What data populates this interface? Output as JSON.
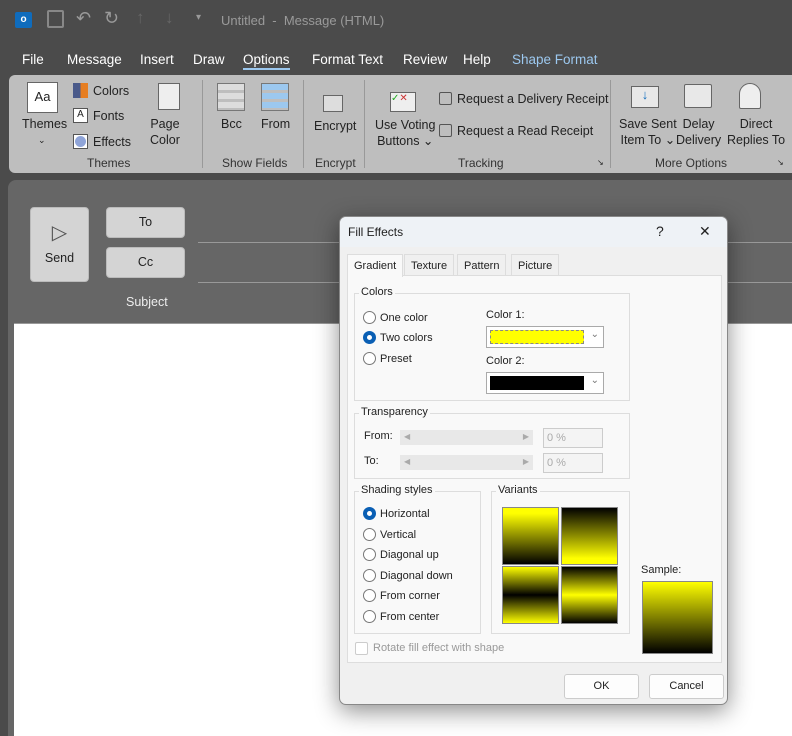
{
  "titlebar": {
    "title": "Untitled  -  Message (HTML)"
  },
  "tabs": [
    "File",
    "Message",
    "Insert",
    "Draw",
    "Options",
    "Format Text",
    "Review",
    "Help",
    "Shape Format"
  ],
  "active_tab": "Options",
  "ribbon": {
    "themes": {
      "themes": "Themes",
      "colors": "Colors",
      "fonts": "Fonts",
      "effects": "Effects",
      "page_color_1": "Page",
      "page_color_2": "Color",
      "group": "Themes"
    },
    "show_fields": {
      "bcc": "Bcc",
      "from": "From",
      "group": "Show Fields"
    },
    "encrypt": {
      "encrypt": "Encrypt",
      "group": "Encrypt"
    },
    "tracking": {
      "voting_1": "Use Voting",
      "voting_2": "Buttons",
      "delivery": "Request a Delivery Receipt",
      "read": "Request a Read Receipt",
      "group": "Tracking"
    },
    "more": {
      "save_1": "Save Sent",
      "save_2": "Item To",
      "delay_1": "Delay",
      "delay_2": "Delivery",
      "direct_1": "Direct",
      "direct_2": "Replies To",
      "group": "More Options"
    }
  },
  "compose": {
    "send": "Send",
    "to": "To",
    "cc": "Cc",
    "subject": "Subject"
  },
  "dialog": {
    "title": "Fill Effects",
    "help": "?",
    "close": "✕",
    "tabs": [
      "Gradient",
      "Texture",
      "Pattern",
      "Picture"
    ],
    "colors_legend": "Colors",
    "color_options": [
      "One color",
      "Two colors",
      "Preset"
    ],
    "color_selected": "Two colors",
    "color1_label": "Color 1:",
    "color1": "#ffff00",
    "color2_label": "Color 2:",
    "color2": "#000000",
    "transparency_legend": "Transparency",
    "from_label": "From:",
    "from_value": "0 %",
    "to_label": "To:",
    "to_value": "0 %",
    "shading_legend": "Shading styles",
    "shading_options": [
      "Horizontal",
      "Vertical",
      "Diagonal up",
      "Diagonal down",
      "From corner",
      "From center"
    ],
    "shading_selected": "Horizontal",
    "variants_legend": "Variants",
    "sample_label": "Sample:",
    "rotate_label": "Rotate fill effect with shape",
    "ok": "OK",
    "cancel": "Cancel"
  }
}
